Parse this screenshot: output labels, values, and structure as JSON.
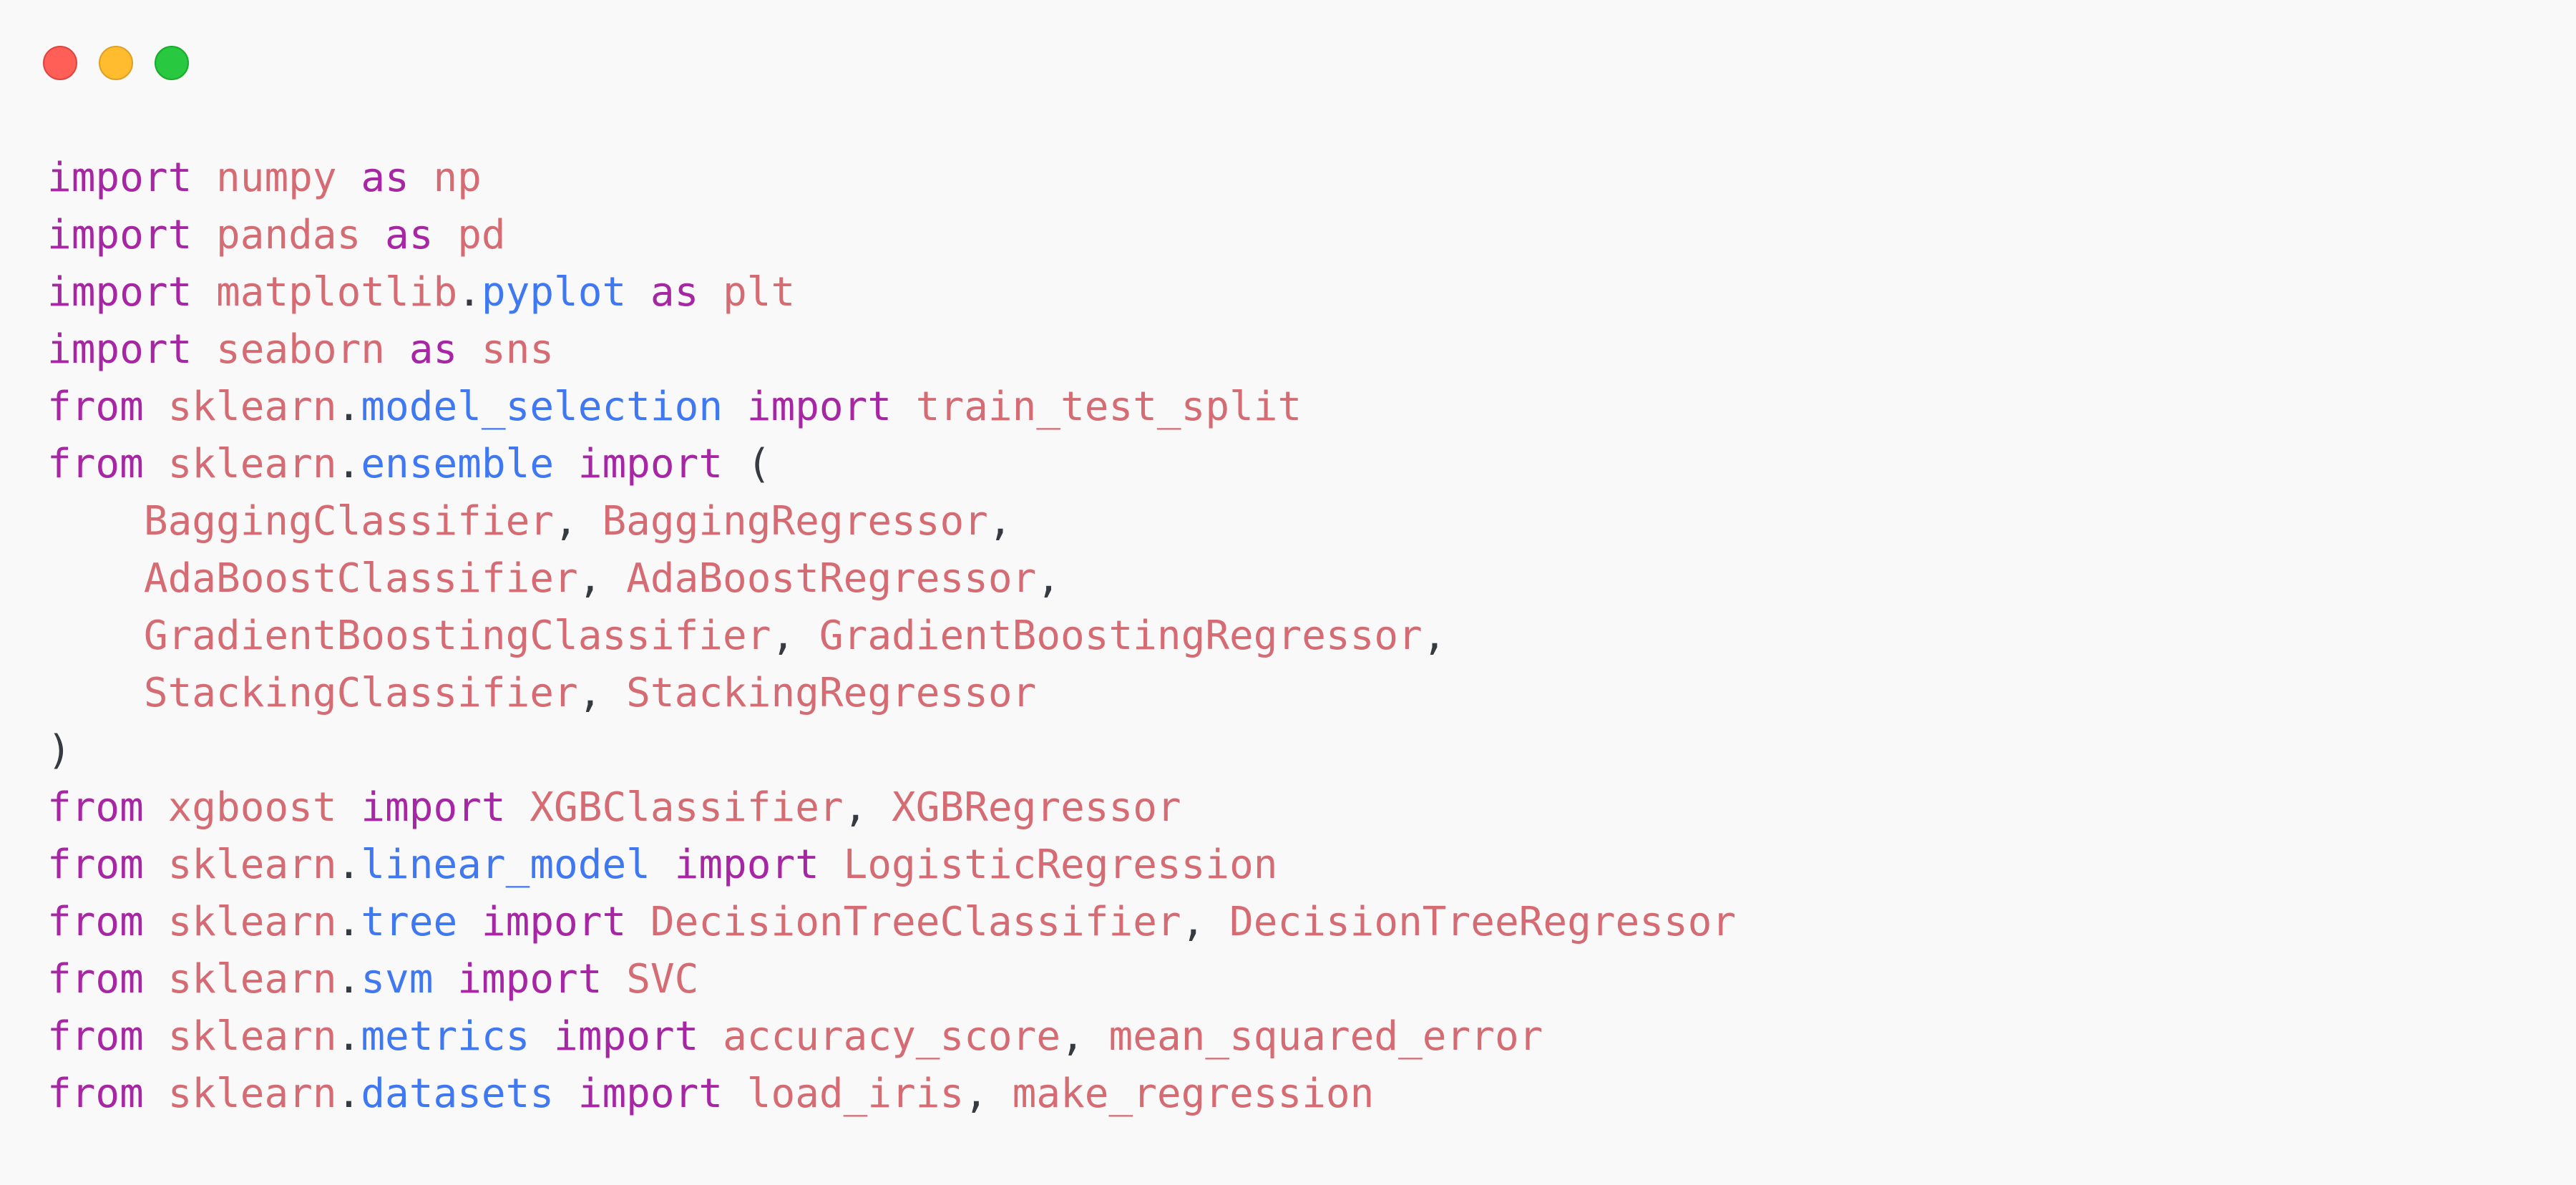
{
  "window": {
    "controls": {
      "close": "close-button",
      "minimize": "minimize-button",
      "zoom": "zoom-button"
    },
    "colors": {
      "background": "#f9f9fa",
      "keyword": "#a626a4",
      "module": "#d56b73",
      "attribute": "#4078f2",
      "text": "#383a42"
    }
  },
  "code": {
    "lines": [
      [
        [
          "kw",
          "import"
        ],
        [
          "p",
          " "
        ],
        [
          "mod",
          "numpy"
        ],
        [
          "p",
          " "
        ],
        [
          "kw",
          "as"
        ],
        [
          "p",
          " "
        ],
        [
          "mod",
          "np"
        ]
      ],
      [
        [
          "kw",
          "import"
        ],
        [
          "p",
          " "
        ],
        [
          "mod",
          "pandas"
        ],
        [
          "p",
          " "
        ],
        [
          "kw",
          "as"
        ],
        [
          "p",
          " "
        ],
        [
          "mod",
          "pd"
        ]
      ],
      [
        [
          "kw",
          "import"
        ],
        [
          "p",
          " "
        ],
        [
          "mod",
          "matplotlib"
        ],
        [
          "p",
          "."
        ],
        [
          "attr",
          "pyplot"
        ],
        [
          "p",
          " "
        ],
        [
          "kw",
          "as"
        ],
        [
          "p",
          " "
        ],
        [
          "mod",
          "plt"
        ]
      ],
      [
        [
          "kw",
          "import"
        ],
        [
          "p",
          " "
        ],
        [
          "mod",
          "seaborn"
        ],
        [
          "p",
          " "
        ],
        [
          "kw",
          "as"
        ],
        [
          "p",
          " "
        ],
        [
          "mod",
          "sns"
        ]
      ],
      [
        [
          "kw",
          "from"
        ],
        [
          "p",
          " "
        ],
        [
          "mod",
          "sklearn"
        ],
        [
          "p",
          "."
        ],
        [
          "attr",
          "model_selection"
        ],
        [
          "p",
          " "
        ],
        [
          "kw",
          "import"
        ],
        [
          "p",
          " "
        ],
        [
          "mod",
          "train_test_split"
        ]
      ],
      [
        [
          "kw",
          "from"
        ],
        [
          "p",
          " "
        ],
        [
          "mod",
          "sklearn"
        ],
        [
          "p",
          "."
        ],
        [
          "attr",
          "ensemble"
        ],
        [
          "p",
          " "
        ],
        [
          "kw",
          "import"
        ],
        [
          "p",
          " ("
        ]
      ],
      [
        [
          "p",
          "    "
        ],
        [
          "mod",
          "BaggingClassifier"
        ],
        [
          "p",
          ", "
        ],
        [
          "mod",
          "BaggingRegressor"
        ],
        [
          "p",
          ","
        ]
      ],
      [
        [
          "p",
          "    "
        ],
        [
          "mod",
          "AdaBoostClassifier"
        ],
        [
          "p",
          ", "
        ],
        [
          "mod",
          "AdaBoostRegressor"
        ],
        [
          "p",
          ","
        ]
      ],
      [
        [
          "p",
          "    "
        ],
        [
          "mod",
          "GradientBoostingClassifier"
        ],
        [
          "p",
          ", "
        ],
        [
          "mod",
          "GradientBoostingRegressor"
        ],
        [
          "p",
          ","
        ]
      ],
      [
        [
          "p",
          "    "
        ],
        [
          "mod",
          "StackingClassifier"
        ],
        [
          "p",
          ", "
        ],
        [
          "mod",
          "StackingRegressor"
        ]
      ],
      [
        [
          "p",
          ")"
        ]
      ],
      [
        [
          "kw",
          "from"
        ],
        [
          "p",
          " "
        ],
        [
          "mod",
          "xgboost"
        ],
        [
          "p",
          " "
        ],
        [
          "kw",
          "import"
        ],
        [
          "p",
          " "
        ],
        [
          "mod",
          "XGBClassifier"
        ],
        [
          "p",
          ", "
        ],
        [
          "mod",
          "XGBRegressor"
        ]
      ],
      [
        [
          "kw",
          "from"
        ],
        [
          "p",
          " "
        ],
        [
          "mod",
          "sklearn"
        ],
        [
          "p",
          "."
        ],
        [
          "attr",
          "linear_model"
        ],
        [
          "p",
          " "
        ],
        [
          "kw",
          "import"
        ],
        [
          "p",
          " "
        ],
        [
          "mod",
          "LogisticRegression"
        ]
      ],
      [
        [
          "kw",
          "from"
        ],
        [
          "p",
          " "
        ],
        [
          "mod",
          "sklearn"
        ],
        [
          "p",
          "."
        ],
        [
          "attr",
          "tree"
        ],
        [
          "p",
          " "
        ],
        [
          "kw",
          "import"
        ],
        [
          "p",
          " "
        ],
        [
          "mod",
          "DecisionTreeClassifier"
        ],
        [
          "p",
          ", "
        ],
        [
          "mod",
          "DecisionTreeRegressor"
        ]
      ],
      [
        [
          "kw",
          "from"
        ],
        [
          "p",
          " "
        ],
        [
          "mod",
          "sklearn"
        ],
        [
          "p",
          "."
        ],
        [
          "attr",
          "svm"
        ],
        [
          "p",
          " "
        ],
        [
          "kw",
          "import"
        ],
        [
          "p",
          " "
        ],
        [
          "mod",
          "SVC"
        ]
      ],
      [
        [
          "kw",
          "from"
        ],
        [
          "p",
          " "
        ],
        [
          "mod",
          "sklearn"
        ],
        [
          "p",
          "."
        ],
        [
          "attr",
          "metrics"
        ],
        [
          "p",
          " "
        ],
        [
          "kw",
          "import"
        ],
        [
          "p",
          " "
        ],
        [
          "mod",
          "accuracy_score"
        ],
        [
          "p",
          ", "
        ],
        [
          "mod",
          "mean_squared_error"
        ]
      ],
      [
        [
          "kw",
          "from"
        ],
        [
          "p",
          " "
        ],
        [
          "mod",
          "sklearn"
        ],
        [
          "p",
          "."
        ],
        [
          "attr",
          "datasets"
        ],
        [
          "p",
          " "
        ],
        [
          "kw",
          "import"
        ],
        [
          "p",
          " "
        ],
        [
          "mod",
          "load_iris"
        ],
        [
          "p",
          ", "
        ],
        [
          "mod",
          "make_regression"
        ]
      ]
    ]
  }
}
